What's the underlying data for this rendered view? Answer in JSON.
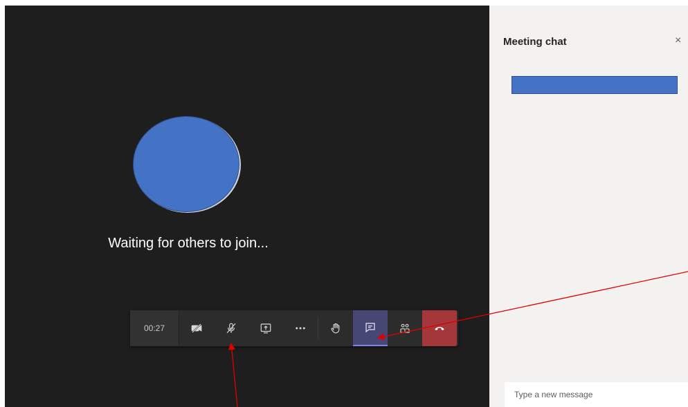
{
  "stage": {
    "status": "Waiting for others to join...",
    "avatar_color": "#4472c4"
  },
  "toolbar": {
    "timer": "00:27",
    "buttons": [
      {
        "id": "camera",
        "icon": "video-off-icon"
      },
      {
        "id": "mic",
        "icon": "mic-off-icon"
      },
      {
        "id": "share",
        "icon": "share-screen-icon"
      },
      {
        "id": "more",
        "icon": "more-icon"
      },
      {
        "id": "raise-hand",
        "icon": "hand-icon"
      },
      {
        "id": "chat",
        "icon": "chat-icon",
        "active": true
      },
      {
        "id": "participants",
        "icon": "people-icon"
      },
      {
        "id": "hang-up",
        "icon": "phone-hangup-icon"
      }
    ],
    "active_color": "#464775",
    "hangup_color": "#a4373a"
  },
  "chat_panel": {
    "title": "Meeting chat",
    "close_glyph": "×",
    "compose_placeholder": "Type a new message"
  },
  "annotations": {
    "arrow_color": "#e00000"
  }
}
